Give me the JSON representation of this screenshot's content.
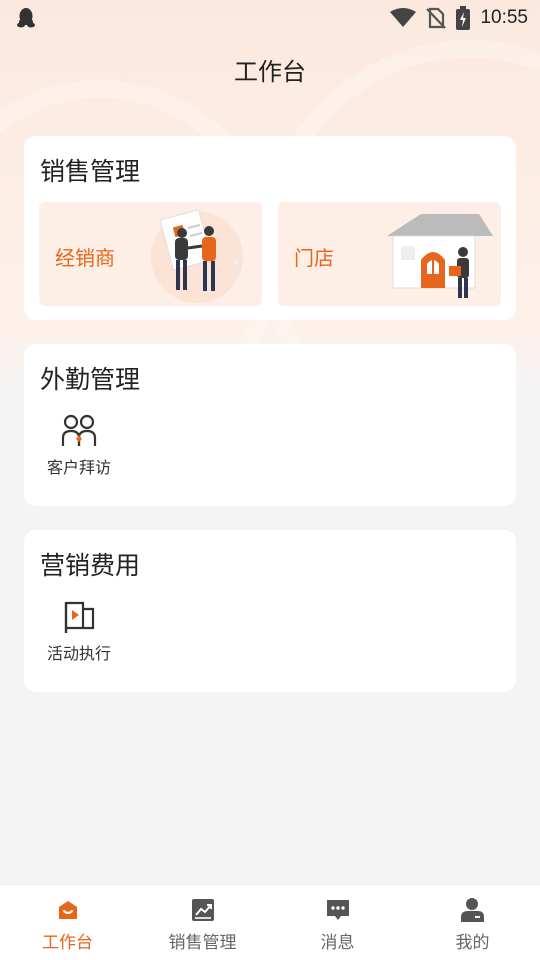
{
  "status_bar": {
    "time": "10:55",
    "icons": [
      "qq-penguin-icon",
      "wifi-icon",
      "no-sim-icon",
      "battery-charging-icon"
    ]
  },
  "header": {
    "title": "工作台"
  },
  "sales_card": {
    "title": "销售管理",
    "tiles": [
      {
        "label": "经销商",
        "illustration": "handshake-illustration"
      },
      {
        "label": "门店",
        "illustration": "store-illustration"
      }
    ]
  },
  "field_card": {
    "title": "外勤管理",
    "tools": [
      {
        "label": "客户拜访",
        "icon": "people-icon"
      }
    ]
  },
  "marketing_card": {
    "title": "营销费用",
    "tools": [
      {
        "label": "活动执行",
        "icon": "flag-play-icon"
      }
    ]
  },
  "tabbar": {
    "items": [
      {
        "label": "工作台",
        "icon": "workbench-icon",
        "active": true
      },
      {
        "label": "销售管理",
        "icon": "chart-icon",
        "active": false
      },
      {
        "label": "消息",
        "icon": "message-icon",
        "active": false
      },
      {
        "label": "我的",
        "icon": "profile-icon",
        "active": false
      }
    ]
  },
  "colors": {
    "accent": "#e8661c",
    "tile_bg": "#fdeee6",
    "page_bg": "#f4f4f5",
    "inactive": "#666666"
  }
}
